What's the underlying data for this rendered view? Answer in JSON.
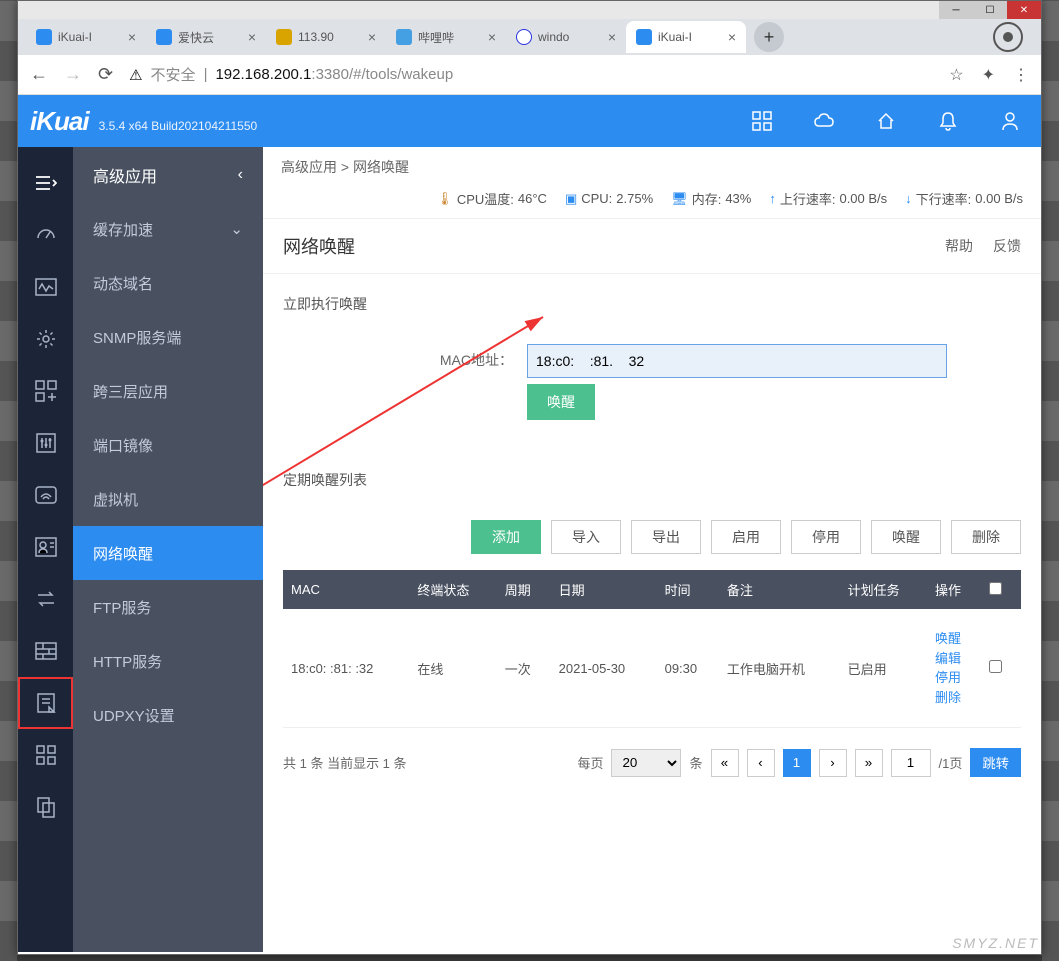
{
  "browser": {
    "tabs": [
      {
        "label": "iKuai-I",
        "fav_color": "#2d8cf0"
      },
      {
        "label": "爱快云",
        "fav_color": "#2d8cf0"
      },
      {
        "label": "113.90",
        "fav_color": "#d9a400"
      },
      {
        "label": "哔哩哔",
        "fav_color": "#44a0e3"
      },
      {
        "label": "windo",
        "fav_color": "#2932e1"
      },
      {
        "label": "iKuai-I",
        "fav_color": "#2d8cf0"
      }
    ],
    "url_security": "不安全",
    "url_host": "192.168.200.1",
    "url_path": ":3380/#/tools/wakeup"
  },
  "header": {
    "logo": "iKuai",
    "version": "3.5.4 x64 Build202104211550"
  },
  "sidebar": {
    "title": "高级应用",
    "items": [
      {
        "label": "缓存加速",
        "expandable": true
      },
      {
        "label": "动态域名"
      },
      {
        "label": "SNMP服务端"
      },
      {
        "label": "跨三层应用"
      },
      {
        "label": "端口镜像"
      },
      {
        "label": "虚拟机"
      },
      {
        "label": "网络唤醒",
        "active": true
      },
      {
        "label": "FTP服务"
      },
      {
        "label": "HTTP服务"
      },
      {
        "label": "UDPXY设置"
      }
    ]
  },
  "breadcrumb": {
    "root": "高级应用",
    "sep": ">",
    "current": "网络唤醒"
  },
  "sysbar": {
    "cpu_temp_label": "CPU温度:",
    "cpu_temp_value": "46°C",
    "cpu_label": "CPU:",
    "cpu_value": "2.75%",
    "mem_label": "内存:",
    "mem_value": "43%",
    "up_label": "上行速率:",
    "up_value": "0.00 B/s",
    "down_label": "下行速率:",
    "down_value": "0.00 B/s"
  },
  "page": {
    "title": "网络唤醒",
    "help": "帮助",
    "feedback": "反馈",
    "immediate_section": "立即执行唤醒",
    "mac_label": "MAC地址：",
    "mac_value": "18:c0:    :81.    32",
    "wake_btn": "唤醒",
    "schedule_section": "定期唤醒列表"
  },
  "toolbar": {
    "add": "添加",
    "import": "导入",
    "export": "导出",
    "enable": "启用",
    "disable": "停用",
    "wake": "唤醒",
    "delete": "删除"
  },
  "table": {
    "cols": {
      "mac": "MAC",
      "status": "终端状态",
      "cycle": "周期",
      "date": "日期",
      "time": "时间",
      "note": "备注",
      "task": "计划任务",
      "op": "操作"
    },
    "rows": [
      {
        "mac": "18:c0:    :81:    :32",
        "status": "在线",
        "cycle": "一次",
        "date": "2021-05-30",
        "time": "09:30",
        "note": "工作电脑开机",
        "task": "已启用",
        "op": [
          "唤醒",
          "编辑",
          "停用",
          "删除"
        ]
      }
    ]
  },
  "pager": {
    "info": "共 1 条 当前显示 1 条",
    "per_page_label": "每页",
    "per_page_value": "20",
    "unit": "条",
    "page_input": "1",
    "page_total": "/1页",
    "jump": "跳转"
  },
  "watermark": "SMYZ.NET"
}
